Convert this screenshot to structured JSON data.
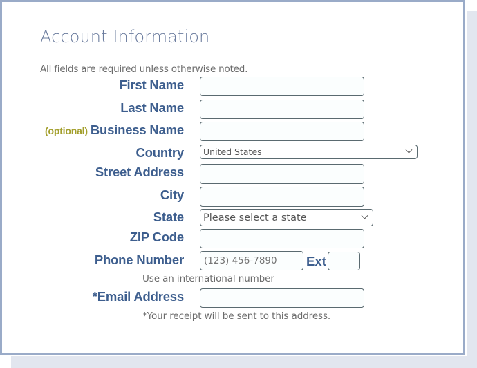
{
  "form": {
    "title": "Account Information",
    "subtitle": "All fields are required unless otherwise noted.",
    "fields": {
      "first_name": {
        "label": "First Name",
        "value": ""
      },
      "last_name": {
        "label": "Last Name",
        "value": ""
      },
      "business_name": {
        "optional_tag": "(optional)",
        "label": "Business Name",
        "value": ""
      },
      "country": {
        "label": "Country",
        "selected": "United States"
      },
      "street_address": {
        "label": "Street Address",
        "value": ""
      },
      "city": {
        "label": "City",
        "value": ""
      },
      "state": {
        "label": "State",
        "selected": "Please select a state"
      },
      "zip_code": {
        "label": "ZIP Code",
        "value": ""
      },
      "phone": {
        "label": "Phone Number",
        "placeholder": "(123) 456-7890",
        "ext_label": "Ext",
        "ext_value": ""
      },
      "email": {
        "label": "*Email Address",
        "value": ""
      }
    },
    "international_link": "Use an international number",
    "email_note": "*Your receipt will be sent to this address."
  }
}
